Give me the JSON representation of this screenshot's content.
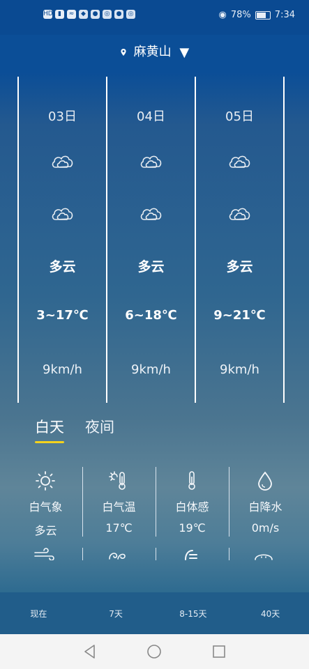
{
  "status_bar": {
    "battery": "78%",
    "time": "7:34",
    "icons": [
      "hd-icon",
      "signal-icon",
      "wifi-icon",
      "app-icon",
      "app-icon",
      "app-icon",
      "app-icon",
      "eye-icon"
    ]
  },
  "header": {
    "location": "麻黄山"
  },
  "forecast": [
    {
      "date": "03日",
      "condition": "多云",
      "temp": "3~17℃",
      "wind": "9km/h"
    },
    {
      "date": "04日",
      "condition": "多云",
      "temp": "6~18℃",
      "wind": "9km/h"
    },
    {
      "date": "05日",
      "condition": "多云",
      "temp": "9~21℃",
      "wind": "9km/h"
    }
  ],
  "tabs": [
    {
      "label": "白天",
      "active": true
    },
    {
      "label": "夜间",
      "active": false
    }
  ],
  "details": [
    {
      "icon": "sun-icon",
      "label": "白气象",
      "value": "多云"
    },
    {
      "icon": "thermometer-sun-icon",
      "label": "白气温",
      "value": "17℃"
    },
    {
      "icon": "thermometer-icon",
      "label": "白体感",
      "value": "19℃"
    },
    {
      "icon": "water-drop-icon",
      "label": "白降水",
      "value": "0m/s"
    }
  ],
  "details_row2_icons": [
    "wind-icon",
    "swirl-icon",
    "gauge-icon",
    "dome-icon"
  ],
  "bottom_nav": [
    "现在",
    "7天",
    "8-15天",
    "40天"
  ],
  "colors": {
    "accent_underline": "#f4d21d",
    "header_blue": "#0b4e97"
  }
}
